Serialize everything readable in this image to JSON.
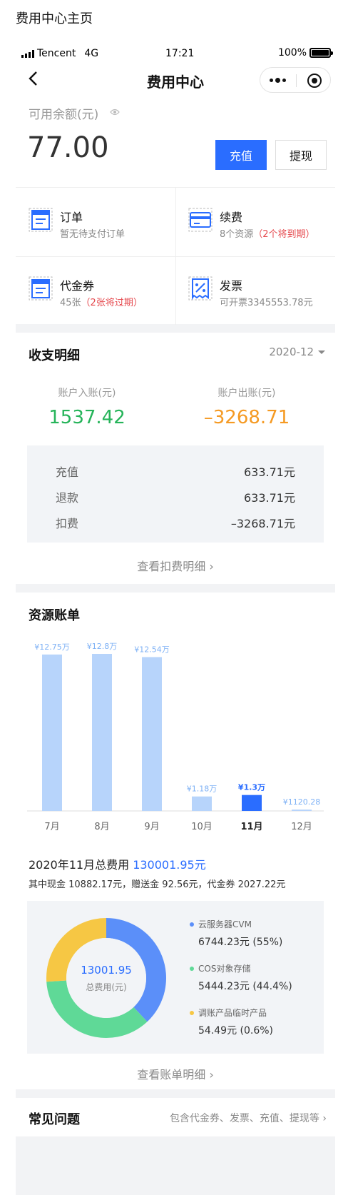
{
  "page_title": "费用中心主页",
  "status_bar": {
    "carrier": "Tencent",
    "network": "4G",
    "time": "17:21",
    "battery": "100%"
  },
  "nav": {
    "title": "费用中心"
  },
  "balance": {
    "label": "可用余额(元)",
    "amount": "77.00",
    "recharge_label": "充值",
    "withdraw_label": "提现"
  },
  "entries": [
    {
      "title": "订单",
      "desc": "暂无待支付订单",
      "warn": "",
      "icon": "order-icon"
    },
    {
      "title": "续费",
      "desc": "8个资源",
      "warn": "（2个将到期）",
      "icon": "renew-card-icon"
    },
    {
      "title": "代金券",
      "desc": "45张",
      "warn": "（2张将过期）",
      "icon": "voucher-icon"
    },
    {
      "title": "发票",
      "desc": "可开票3345553.78元",
      "warn": "",
      "icon": "invoice-icon"
    }
  ],
  "detail": {
    "title": "收支明细",
    "month": "2020-12",
    "income_label": "账户入账(元)",
    "income_value": "1537.42",
    "expense_label": "账户出账(元)",
    "expense_value": "–3268.71",
    "rows": [
      {
        "label": "充值",
        "value": "633.71元"
      },
      {
        "label": "退款",
        "value": "633.71元"
      },
      {
        "label": "扣费",
        "value": "–3268.71元"
      }
    ],
    "link": "查看扣费明细"
  },
  "bill": {
    "title": "资源账单",
    "total_prefix": "2020年11月总费用",
    "total_value": "130001.95元",
    "sub_line": "其中现金 10882.17元，赠送金 92.56元，代金券 2027.22元",
    "donut_center_value": "13001.95",
    "donut_center_label": "总费用(元)",
    "legend": [
      {
        "name": "云服务器CVM",
        "value": "6744.23元 (55%)",
        "color": "#5b8ff9"
      },
      {
        "name": "COS对象存储",
        "value": "5444.23元 (44.4%)",
        "color": "#5fd997"
      },
      {
        "name": "调账产品临时产品",
        "value": "54.49元 (0.6%)",
        "color": "#f6c744"
      }
    ],
    "link": "查看账单明细"
  },
  "chart_data": {
    "type": "bar",
    "categories": [
      "7月",
      "8月",
      "9月",
      "10月",
      "11月",
      "12月"
    ],
    "values": [
      127500,
      128000,
      125400,
      11800,
      13000,
      1120.28
    ],
    "labels": [
      "¥12.75万",
      "¥12.8万",
      "¥12.54万",
      "¥1.18万",
      "¥1.3万",
      "¥1120.28"
    ],
    "highlight_index": 4,
    "colors": {
      "normal": "#b7d4fb",
      "highlight": "#2a6dff",
      "label": "#7eb1f5",
      "label_highlight": "#2a6dff"
    }
  },
  "donut": {
    "type": "pie",
    "segments": [
      {
        "value": 38,
        "color": "#5b8ff9"
      },
      {
        "value": 36,
        "color": "#5fd997"
      },
      {
        "value": 26,
        "color": "#f6c744"
      }
    ]
  },
  "faq": {
    "title": "常见问题",
    "desc": "包含代金券、发票、充值、提现等"
  }
}
